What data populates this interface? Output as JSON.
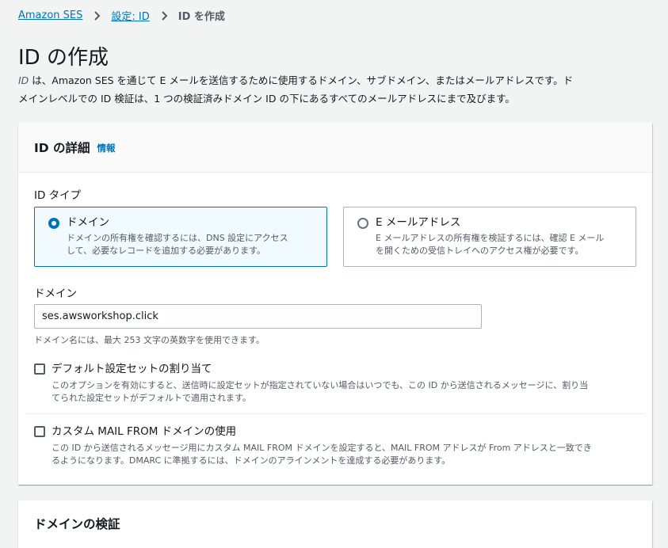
{
  "breadcrumb": {
    "items": [
      "Amazon SES",
      "設定: ID"
    ],
    "current": "ID を作成"
  },
  "page": {
    "title": "ID の作成",
    "desc_term": "ID",
    "desc_line1": " は、Amazon SES を通じて E メールを送信するために使用するドメイン、サブドメイン、またはメールアドレスです。ド",
    "desc_line2": "メインレベルでの ID 検証は、1 つの検証済みドメイン ID の下にあるすべてのメールアドレスにまで及びます。"
  },
  "details": {
    "title": "ID の詳細",
    "info": "情報",
    "id_type_label": "ID タイプ",
    "tiles": [
      {
        "title": "ドメイン",
        "desc1": "ドメインの所有権を確認するには、DNS 設定にアクセス",
        "desc2": "して、必要なレコードを追加する必要があります。",
        "selected": true
      },
      {
        "title": "E メールアドレス",
        "desc1": "E メールアドレスの所有権を検証するには、確認 E メール",
        "desc2": "を開くための受信トレイへのアクセス権が必要です。",
        "selected": false
      }
    ],
    "domain_label": "ドメイン",
    "domain_value": "ses.awsworkshop.click",
    "domain_hint": "ドメイン名には、最大 253 文字の英数字を使用できます。",
    "config_set": {
      "title": "デフォルト設定セットの割り当て",
      "desc1": "このオプションを有効にすると、送信時に設定セットが指定されていない場合はいつでも、この ID から送信されるメッセージに、割り当",
      "desc2": "てられた設定セットがデフォルトで適用されます。"
    },
    "mail_from": {
      "title": "カスタム MAIL FROM ドメインの使用",
      "desc1": "この ID から送信されるメッセージ用にカスタム MAIL FROM ドメインを設定すると、MAIL FROM アドレスが From アドレスと一致でき",
      "desc2": "るようになります。DMARC に準拠するには、ドメインのアラインメントを達成する必要があります。"
    }
  },
  "next_panel": {
    "title": "ドメインの検証"
  },
  "colors": {
    "accent": "#0073bb",
    "background": "#f2f3f3"
  }
}
